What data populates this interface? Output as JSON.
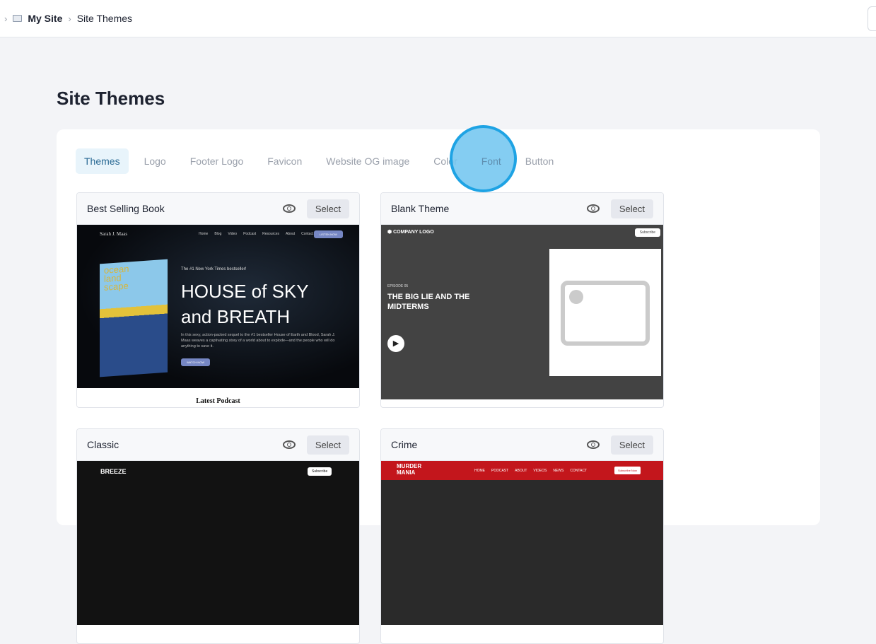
{
  "breadcrumb": {
    "items": [
      "My Site",
      "Site Themes"
    ]
  },
  "page_title": "Site Themes",
  "tabs": [
    "Themes",
    "Logo",
    "Footer Logo",
    "Favicon",
    "Website OG image",
    "Color",
    "Font",
    "Button"
  ],
  "active_tab": "Themes",
  "select_label": "Select",
  "themes": [
    {
      "name": "Best Selling Book",
      "preview": {
        "brand": "Sarah J. Maas",
        "nav": [
          "Home",
          "Blog",
          "Video",
          "Podcast",
          "Resources",
          "About",
          "Contact"
        ],
        "cta": "LISTEN NOW",
        "kicker": "The #1 New York Times bestseller!",
        "headline1": "HOUSE of SKY",
        "headline2": "and BREATH",
        "body": "In this sexy, action-packed sequel to the #1 bestseller House of Earth and Blood, Sarah J. Maas weaves a captivating story of a world about to explode—and the people who will do anything to save it.",
        "button": "WATCH NOW",
        "cover": "ocean land scape",
        "section": "Latest Podcast"
      }
    },
    {
      "name": "Blank Theme",
      "preview": {
        "brand": "COMPANY LOGO",
        "subscribe": "Subscribe",
        "kicker": "EPISODE 05",
        "headline": "THE BIG LIE AND THE MIDTERMS"
      }
    },
    {
      "name": "Classic",
      "preview": {
        "brand": "BREEZE",
        "subscribe": "Subscribe"
      }
    },
    {
      "name": "Crime",
      "preview": {
        "brand": "MURDER MANIA",
        "nav": [
          "HOME",
          "PODCAST",
          "ABOUT",
          "VIDEOS",
          "NEWS",
          "CONTACT"
        ],
        "subscribe": "Subscribe Now"
      }
    }
  ]
}
